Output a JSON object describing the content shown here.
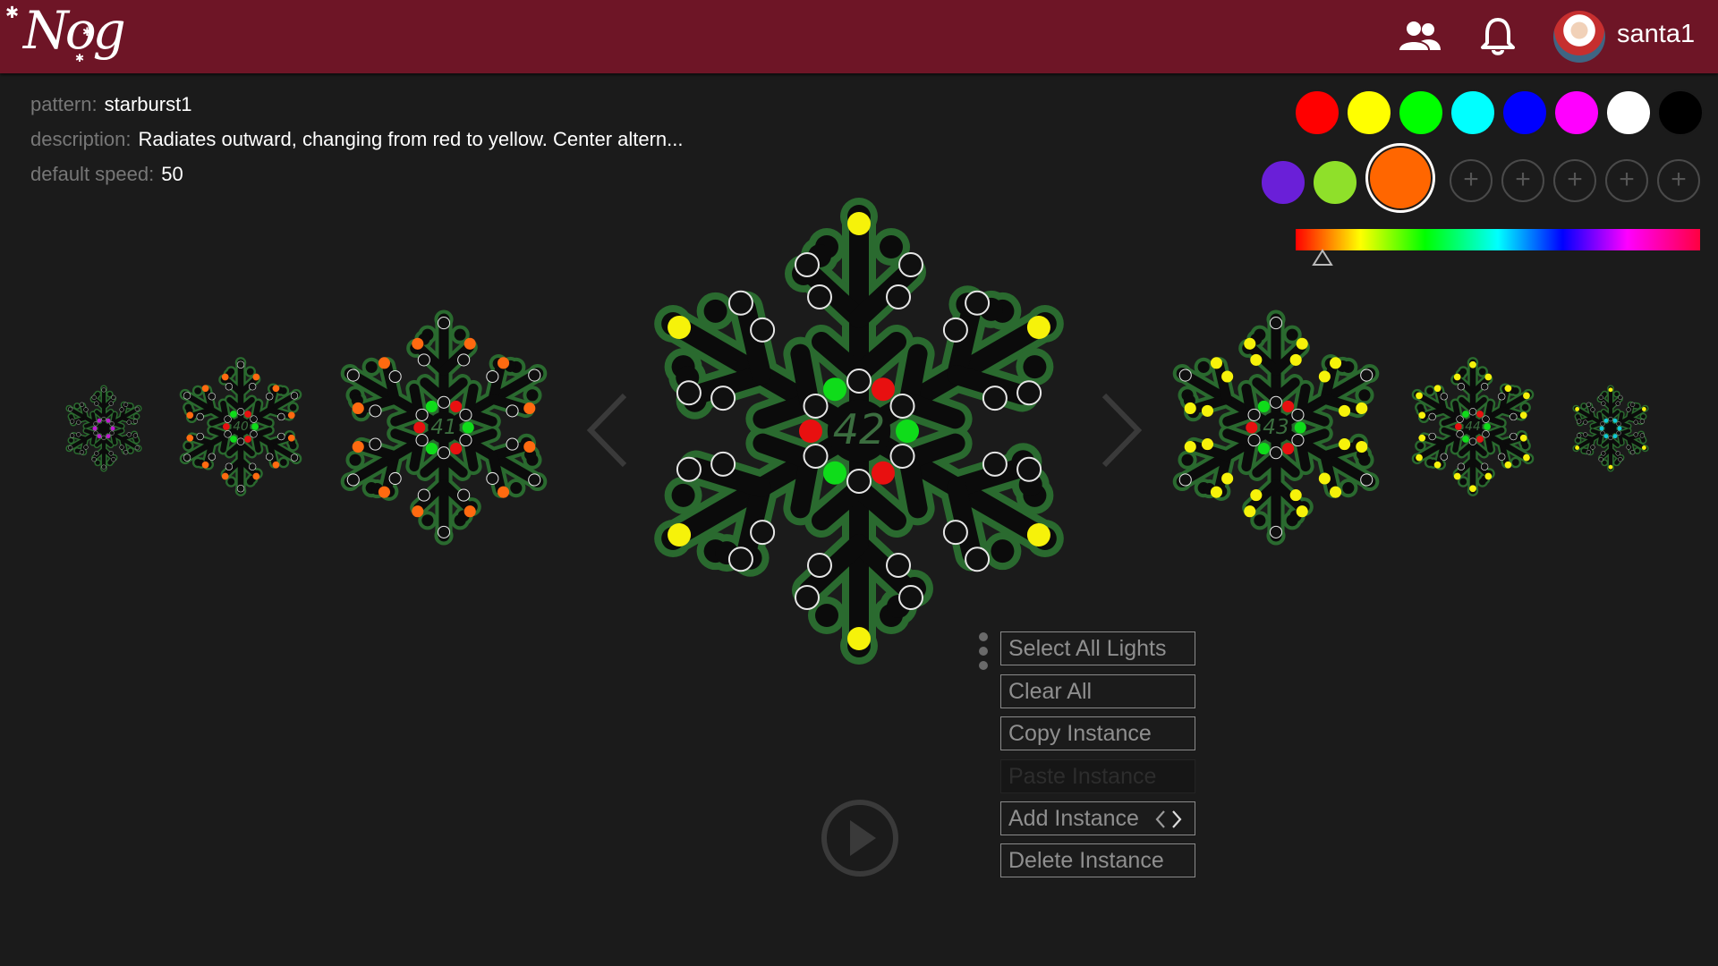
{
  "header": {
    "logo_text": "Nog",
    "user_name": "santa1",
    "icons": [
      "people-icon",
      "bell-icon",
      "avatar"
    ]
  },
  "pattern": {
    "pattern_label": "pattern:",
    "pattern_value": "starburst1",
    "description_label": "description:",
    "description_value": "Radiates outward, changing from red to yellow. Center altern...",
    "speed_label": "default speed:",
    "speed_value": "50"
  },
  "palette": {
    "row1": [
      "#ff0000",
      "#ffff00",
      "#00ff00",
      "#00ffff",
      "#0000ff",
      "#ff00ff",
      "#ffffff",
      "#000000"
    ],
    "row2": [
      "#6a1fd8",
      "#8fe02a",
      "#ff6600"
    ],
    "selected_color": "#ff6600",
    "add_slot_symbol": "+",
    "add_slots": 5
  },
  "spectrum": {
    "marker_position_fraction": 0.07
  },
  "instances": {
    "current": "42",
    "previous": "41",
    "next": "43",
    "prev2": "40",
    "next2": "44"
  },
  "colors": {
    "red": "#e81010",
    "green": "#0fdc1a",
    "yellow": "#f6f20a",
    "orange": "#ff6a10",
    "off": "#101010",
    "flake_outline": "#2a6a2f"
  },
  "menu": {
    "select_all": "Select All Lights",
    "clear_all": "Clear All",
    "copy_instance": "Copy Instance",
    "paste_instance": "Paste Instance",
    "add_instance": "Add Instance",
    "delete_instance": "Delete Instance"
  }
}
